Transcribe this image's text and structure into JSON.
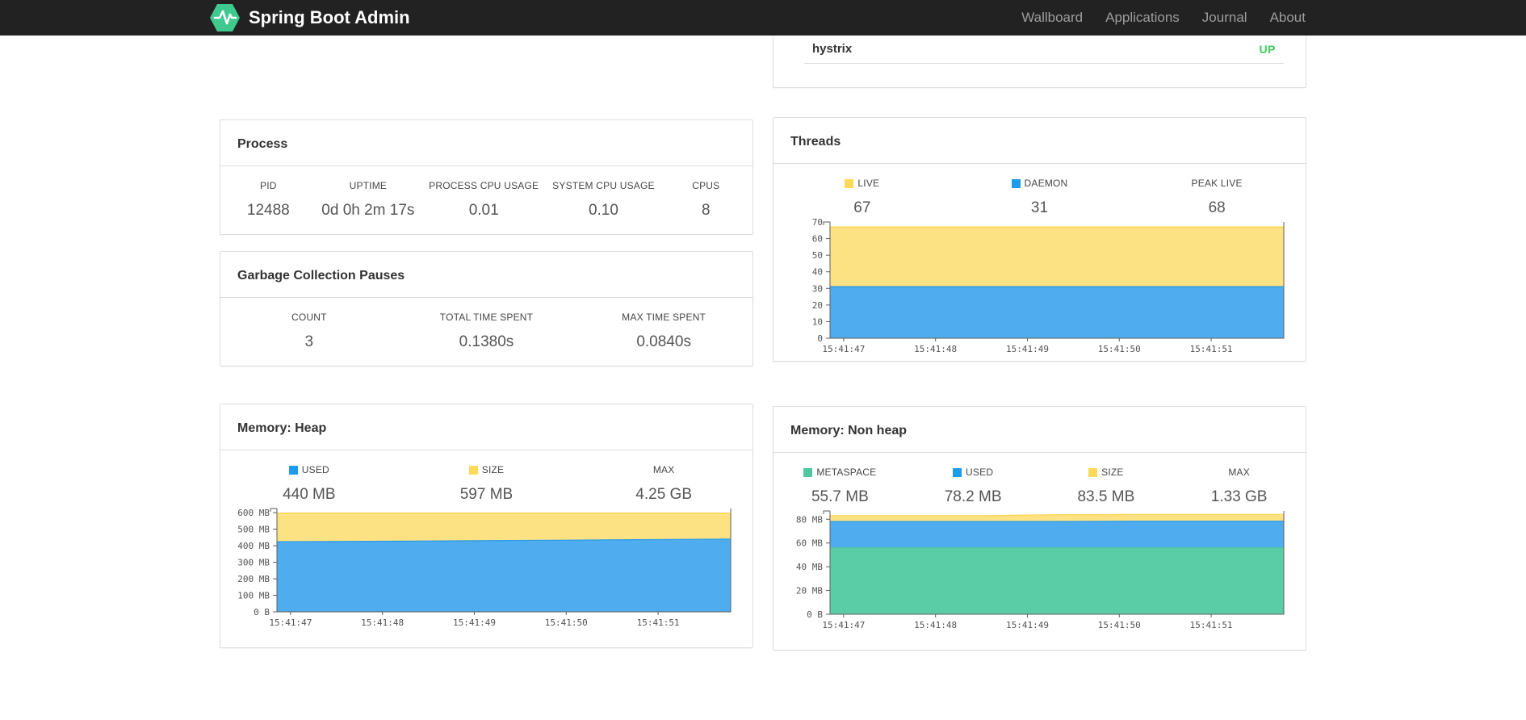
{
  "navbar": {
    "brand": "Spring Boot Admin",
    "brand_color": "#3fc98f",
    "items": [
      {
        "label": "Wallboard"
      },
      {
        "label": "Applications"
      },
      {
        "label": "Journal"
      },
      {
        "label": "About"
      }
    ]
  },
  "application_status_panel": {
    "app_name": "hystrix",
    "status": "UP",
    "status_color": "#3ecb5b"
  },
  "process_panel": {
    "title": "Process",
    "metrics": [
      {
        "label": "PID",
        "value": "12488"
      },
      {
        "label": "UPTIME",
        "value": "0d 0h 2m 17s"
      },
      {
        "label": "PROCESS CPU USAGE",
        "value": "0.01"
      },
      {
        "label": "SYSTEM CPU USAGE",
        "value": "0.10"
      },
      {
        "label": "CPUS",
        "value": "8"
      }
    ]
  },
  "gc_panel": {
    "title": "Garbage Collection Pauses",
    "metrics": [
      {
        "label": "COUNT",
        "value": "3"
      },
      {
        "label": "TOTAL TIME SPENT",
        "value": "0.1380s"
      },
      {
        "label": "MAX TIME SPENT",
        "value": "0.0840s"
      }
    ]
  },
  "threads_panel": {
    "title": "Threads",
    "metrics": [
      {
        "label": "LIVE",
        "value": "67",
        "color": "#FFD95A"
      },
      {
        "label": "DAEMON",
        "value": "31",
        "color": "#1E9BE9"
      },
      {
        "label": "PEAK LIVE",
        "value": "68"
      }
    ]
  },
  "heap_panel": {
    "title": "Memory: Heap",
    "metrics": [
      {
        "label": "USED",
        "value": "440 MB",
        "color": "#1E9BE9"
      },
      {
        "label": "SIZE",
        "value": "597 MB",
        "color": "#FFD95A"
      },
      {
        "label": "MAX",
        "value": "4.25 GB"
      }
    ]
  },
  "nonheap_panel": {
    "title": "Memory: Non heap",
    "metrics": [
      {
        "label": "METASPACE",
        "value": "55.7 MB",
        "color": "#4DC8A0"
      },
      {
        "label": "USED",
        "value": "78.2 MB",
        "color": "#1E9BE9"
      },
      {
        "label": "SIZE",
        "value": "83.5 MB",
        "color": "#FFD95A"
      },
      {
        "label": "MAX",
        "value": "1.33 GB"
      }
    ]
  },
  "chart_data": [
    {
      "id": "threads",
      "type": "area",
      "title": "Threads",
      "x": [
        "15:41:47",
        "15:41:48",
        "15:41:49",
        "15:41:50",
        "15:41:51"
      ],
      "ylim": [
        0,
        70
      ],
      "plot_max": 70,
      "grid": false,
      "y_ticks": [
        {
          "v": 0,
          "label": "0"
        },
        {
          "v": 10,
          "label": "10"
        },
        {
          "v": 20,
          "label": "20"
        },
        {
          "v": 30,
          "label": "30"
        },
        {
          "v": 40,
          "label": "40"
        },
        {
          "v": 50,
          "label": "50"
        },
        {
          "v": 60,
          "label": "60"
        },
        {
          "v": 70,
          "label": "70"
        }
      ],
      "series": [
        {
          "name": "DAEMON",
          "color": "#2D9CE8",
          "fill": "#4FADEF",
          "tops": [
            31,
            31,
            31,
            31,
            31,
            31,
            31
          ]
        },
        {
          "name": "LIVE",
          "color": "#FFD554",
          "fill": "#FDE283",
          "tops": [
            67,
            67,
            67,
            67,
            67,
            67,
            67
          ]
        }
      ]
    },
    {
      "id": "heap",
      "type": "area",
      "title": "Memory: Heap",
      "x": [
        "15:41:47",
        "15:41:48",
        "15:41:49",
        "15:41:50",
        "15:41:51"
      ],
      "ylim": [
        0,
        625
      ],
      "plot_max": 625,
      "grid": false,
      "y_ticks": [
        {
          "v": 0,
          "label": "0 B"
        },
        {
          "v": 100,
          "label": "100 MB"
        },
        {
          "v": 200,
          "label": "200 MB"
        },
        {
          "v": 300,
          "label": "300 MB"
        },
        {
          "v": 400,
          "label": "400 MB"
        },
        {
          "v": 500,
          "label": "500 MB"
        },
        {
          "v": 600,
          "label": "600 MB"
        }
      ],
      "series": [
        {
          "name": "USED",
          "color": "#2D9CE8",
          "fill": "#4FADEF",
          "tops": [
            424,
            426,
            428,
            431,
            434,
            437,
            440
          ]
        },
        {
          "name": "SIZE",
          "color": "#FFD554",
          "fill": "#FDE283",
          "tops": [
            597,
            597,
            597,
            597,
            597,
            597,
            597
          ]
        }
      ]
    },
    {
      "id": "nonheap",
      "type": "area",
      "title": "Memory: Non heap",
      "x": [
        "15:41:47",
        "15:41:48",
        "15:41:49",
        "15:41:50",
        "15:41:51"
      ],
      "ylim": [
        0,
        87
      ],
      "plot_max": 87,
      "grid": false,
      "y_ticks": [
        {
          "v": 0,
          "label": "0 B"
        },
        {
          "v": 20,
          "label": "20 MB"
        },
        {
          "v": 40,
          "label": "40 MB"
        },
        {
          "v": 60,
          "label": "60 MB"
        },
        {
          "v": 80,
          "label": "80 MB"
        }
      ],
      "series": [
        {
          "name": "METASPACE",
          "color": "#4FC69E",
          "fill": "#5BCDA6",
          "tops": [
            56,
            56,
            56,
            56,
            56,
            56,
            56
          ]
        },
        {
          "name": "USED",
          "color": "#2D9CE8",
          "fill": "#4FADEF",
          "tops": [
            78,
            78,
            78,
            78,
            78.3,
            78.3,
            78.3
          ]
        },
        {
          "name": "SIZE",
          "color": "#FFD554",
          "fill": "#FDE283",
          "tops": [
            83,
            83,
            83,
            83.8,
            84,
            84,
            84
          ]
        }
      ]
    }
  ]
}
